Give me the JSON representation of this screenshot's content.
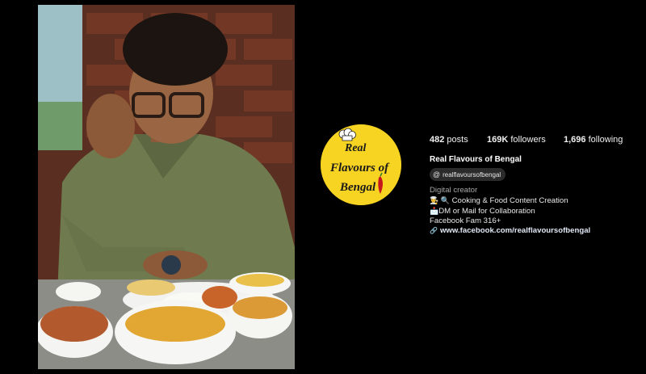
{
  "profile": {
    "posts_count": "482",
    "posts_label": "posts",
    "followers_count": "169K",
    "followers_label": "followers",
    "following_count": "1,696",
    "following_label": "following",
    "display_name": "Real Flavours of Bengal",
    "threads_handle": "realflavoursofbengal",
    "category": "Digital creator",
    "bio_lines": [
      "Cooking & Food Content Creation",
      "DM or Mail for Collaboration",
      "Facebook Fam 316+"
    ],
    "bio_emojis": [
      "👨‍🍳 🔍",
      "📩"
    ],
    "website": "www.facebook.com/realflavoursofbengal"
  },
  "logo": {
    "line1": "Real",
    "line2": "Flavours of",
    "line3": "Bengal"
  },
  "colors": {
    "background": "#000000",
    "logo_yellow": "#f7d322",
    "accent_red": "#c4161c"
  },
  "icons": {
    "threads": "threads-icon",
    "link": "link-icon",
    "chef_hat": "chef-hat-icon"
  }
}
